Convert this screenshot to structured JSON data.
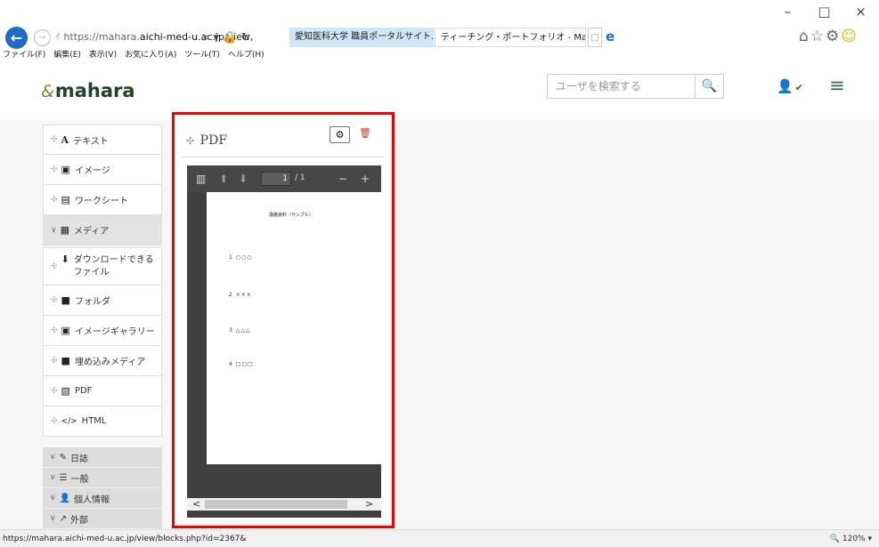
{
  "browser": {
    "window_controls": {
      "minimize": "–",
      "maximize": "□",
      "close": "×"
    },
    "back_icon": "←",
    "forward_icon": "→",
    "address": {
      "page_icon": "ｲ",
      "prefix": "https://mahara.",
      "host": "aichi-med-u.ac.jp",
      "path": "/view,",
      "controls": "⌕ ▾ 🔒 ↻"
    },
    "tabs": [
      {
        "label": "愛知医科大学 職員ポータルサイト..."
      },
      {
        "label": "ティーチング・ポートフォリオ - Ma...",
        "close": "×"
      }
    ],
    "new_tab_icon": "□",
    "ie_logo": "e",
    "right_icons": "⌂☆⚙",
    "smiley": "☺",
    "menu": [
      "ファイル(F)",
      "編集(E)",
      "表示(V)",
      "お気に入り(A)",
      "ツール(T)",
      "ヘルプ(H)"
    ]
  },
  "header": {
    "logo_mark": "&",
    "logo_text": "mahara",
    "search": {
      "placeholder": "ユーザを検索する",
      "icon": "🔍"
    },
    "user_icon": "👤",
    "user_chevron": "✔",
    "menu_icon": "≡"
  },
  "sidebar": {
    "items": [
      {
        "icon": "A",
        "label": "テキスト"
      },
      {
        "icon": "▣",
        "label": "イメージ"
      },
      {
        "icon": "▤",
        "label": "ワークシート"
      }
    ],
    "media_category": {
      "label": "メディア",
      "icon": "▦"
    },
    "media_items": [
      {
        "icon": "⬇",
        "label": "ダウンロードできる",
        "label2": "ファイル"
      },
      {
        "icon": "■",
        "label": "フォルダ"
      },
      {
        "icon": "▣",
        "label": "イメージギャラリー"
      },
      {
        "icon": "■",
        "label": "埋め込みメディア"
      },
      {
        "icon": "▧",
        "label": "PDF"
      },
      {
        "icon": "</>",
        "label": "HTML"
      }
    ],
    "categories": [
      {
        "icon": "✎",
        "label": "日誌"
      },
      {
        "icon": "☰",
        "label": "一般"
      },
      {
        "icon": "👤",
        "label": "個人情報"
      },
      {
        "icon": "↗",
        "label": "外部"
      }
    ],
    "collapse_icon": "«",
    "plus_icon": "✣",
    "chevron_icon": "∨"
  },
  "block": {
    "title": "PDF",
    "config_icon": "⚙",
    "delete_icon": "🗑",
    "viewer": {
      "toolbar": {
        "sidebar_icon": "▥",
        "up_icon": "⬆",
        "down_icon": "⬇",
        "page": "1",
        "of": "/ 1",
        "zoom_out": "−",
        "zoom_in": "+"
      },
      "doc_title": "講義資料（サンプル）",
      "lines": [
        "1 ○○○",
        "2 ×××",
        "3 △△△",
        "4 □□□"
      ],
      "scroll_left": "<",
      "scroll_right": ">"
    }
  },
  "status_bar": {
    "url": "https://mahara.aichi-med-u.ac.jp/view/blocks.php?id=2367&",
    "zoom": "🔍 120%  ▾"
  }
}
